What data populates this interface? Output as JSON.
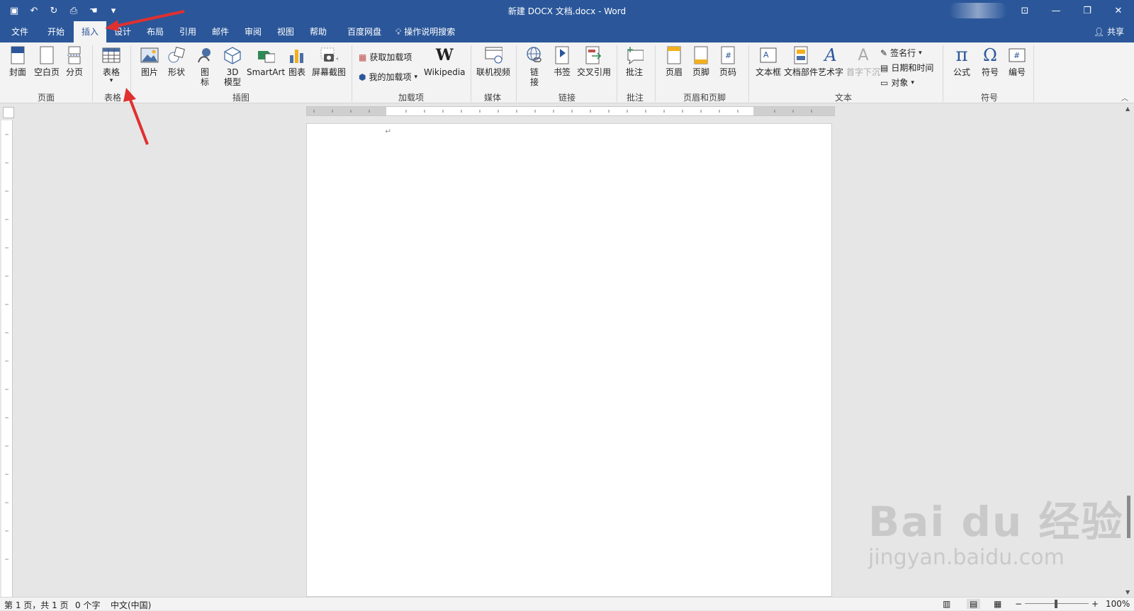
{
  "window": {
    "title": "新建 DOCX 文档.docx - Word"
  },
  "qat": {
    "icons": [
      "save-icon",
      "undo-icon",
      "redo-icon",
      "print-preview-icon",
      "touch-mode-icon",
      "customize-qat-icon"
    ]
  },
  "tabs": [
    {
      "label": "文件"
    },
    {
      "label": "开始"
    },
    {
      "label": "插入",
      "active": true
    },
    {
      "label": "设计"
    },
    {
      "label": "布局"
    },
    {
      "label": "引用"
    },
    {
      "label": "邮件"
    },
    {
      "label": "审阅"
    },
    {
      "label": "视图"
    },
    {
      "label": "帮助"
    },
    {
      "label": "百度网盘"
    },
    {
      "label": "操作说明搜索"
    }
  ],
  "share": "共享",
  "ribbon": {
    "pages": {
      "cover": "封面",
      "blank": "空白页",
      "break": "分页",
      "group": "页面"
    },
    "tables": {
      "table": "表格",
      "group": "表格"
    },
    "illustrations": {
      "picture": "图片",
      "shapes": "形状",
      "icons": "图标",
      "model3d": "3D模型",
      "smartart": "SmartArt",
      "chart": "图表",
      "screenshot": "屏幕截图",
      "group": "插图"
    },
    "addins": {
      "get": "获取加载项",
      "my": "我的加载项",
      "wikipedia": "Wikipedia",
      "group": "加载项"
    },
    "media": {
      "online_video": "联机视频",
      "group": "媒体"
    },
    "links": {
      "link": "链接",
      "bookmark": "书签",
      "cross_ref": "交叉引用",
      "group": "链接"
    },
    "comments": {
      "comment": "批注",
      "group": "批注"
    },
    "header_footer": {
      "header": "页眉",
      "footer": "页脚",
      "page_number": "页码",
      "group": "页眉和页脚"
    },
    "text": {
      "textbox": "文本框",
      "quickparts": "文档部件",
      "wordart": "艺术字",
      "dropcap": "首字下沉",
      "signature": "签名行",
      "datetime": "日期和时间",
      "object": "对象",
      "group": "文本"
    },
    "symbols": {
      "equation": "公式",
      "symbol": "符号",
      "number": "编号",
      "group": "符号"
    }
  },
  "status": {
    "page": "第 1 页，共 1 页",
    "words": "0 个字",
    "lang": "中文(中国)",
    "zoom": "100%"
  },
  "watermark": {
    "logo": "Bai du 经验",
    "url": "jingyan.baidu.com"
  }
}
